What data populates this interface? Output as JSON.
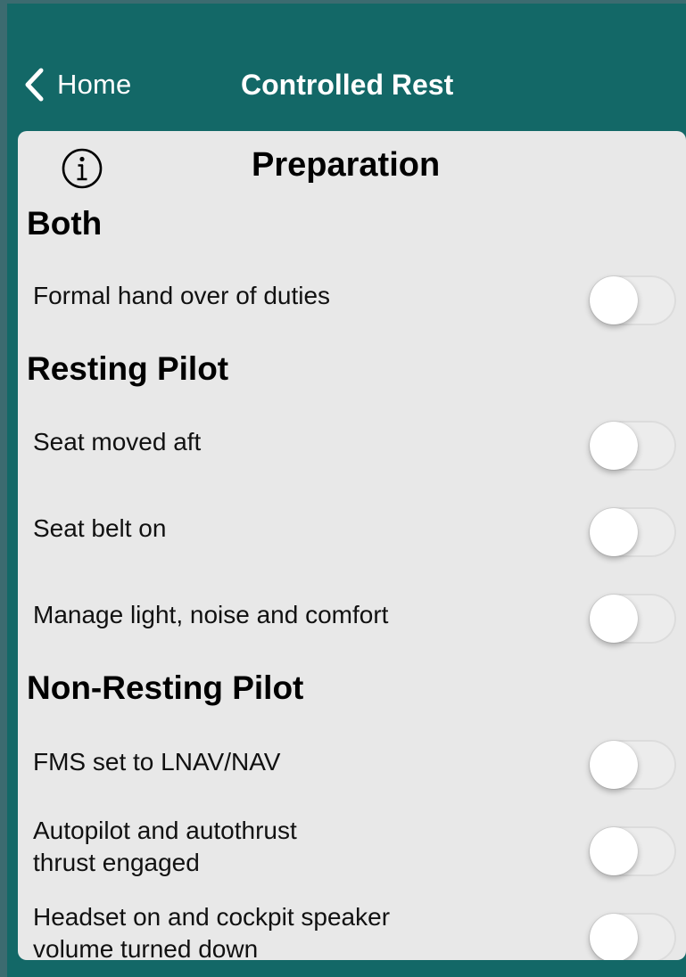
{
  "nav": {
    "back_label": "Home",
    "title": "Controlled Rest"
  },
  "panel": {
    "title": "Preparation",
    "info_icon": "info-circle-icon"
  },
  "sections": [
    {
      "heading": "Both",
      "items": [
        {
          "label": "Formal hand over of duties",
          "checked": false
        }
      ]
    },
    {
      "heading": "Resting Pilot",
      "items": [
        {
          "label": "Seat moved aft",
          "checked": false
        },
        {
          "label": "Seat belt on",
          "checked": false
        },
        {
          "label": "Manage light, noise and comfort",
          "checked": false
        }
      ]
    },
    {
      "heading": "Non-Resting Pilot",
      "items": [
        {
          "label": "FMS set to LNAV/NAV",
          "checked": false
        },
        {
          "label": "Autopilot and autothrust\nthrust engaged",
          "checked": false
        },
        {
          "label": "Headset on and cockpit speaker\nvolume turned down",
          "checked": false
        }
      ]
    }
  ],
  "colors": {
    "nav_bar": "#136867",
    "panel_bg": "#e8e8e8",
    "toggle_off": "#ececec"
  }
}
